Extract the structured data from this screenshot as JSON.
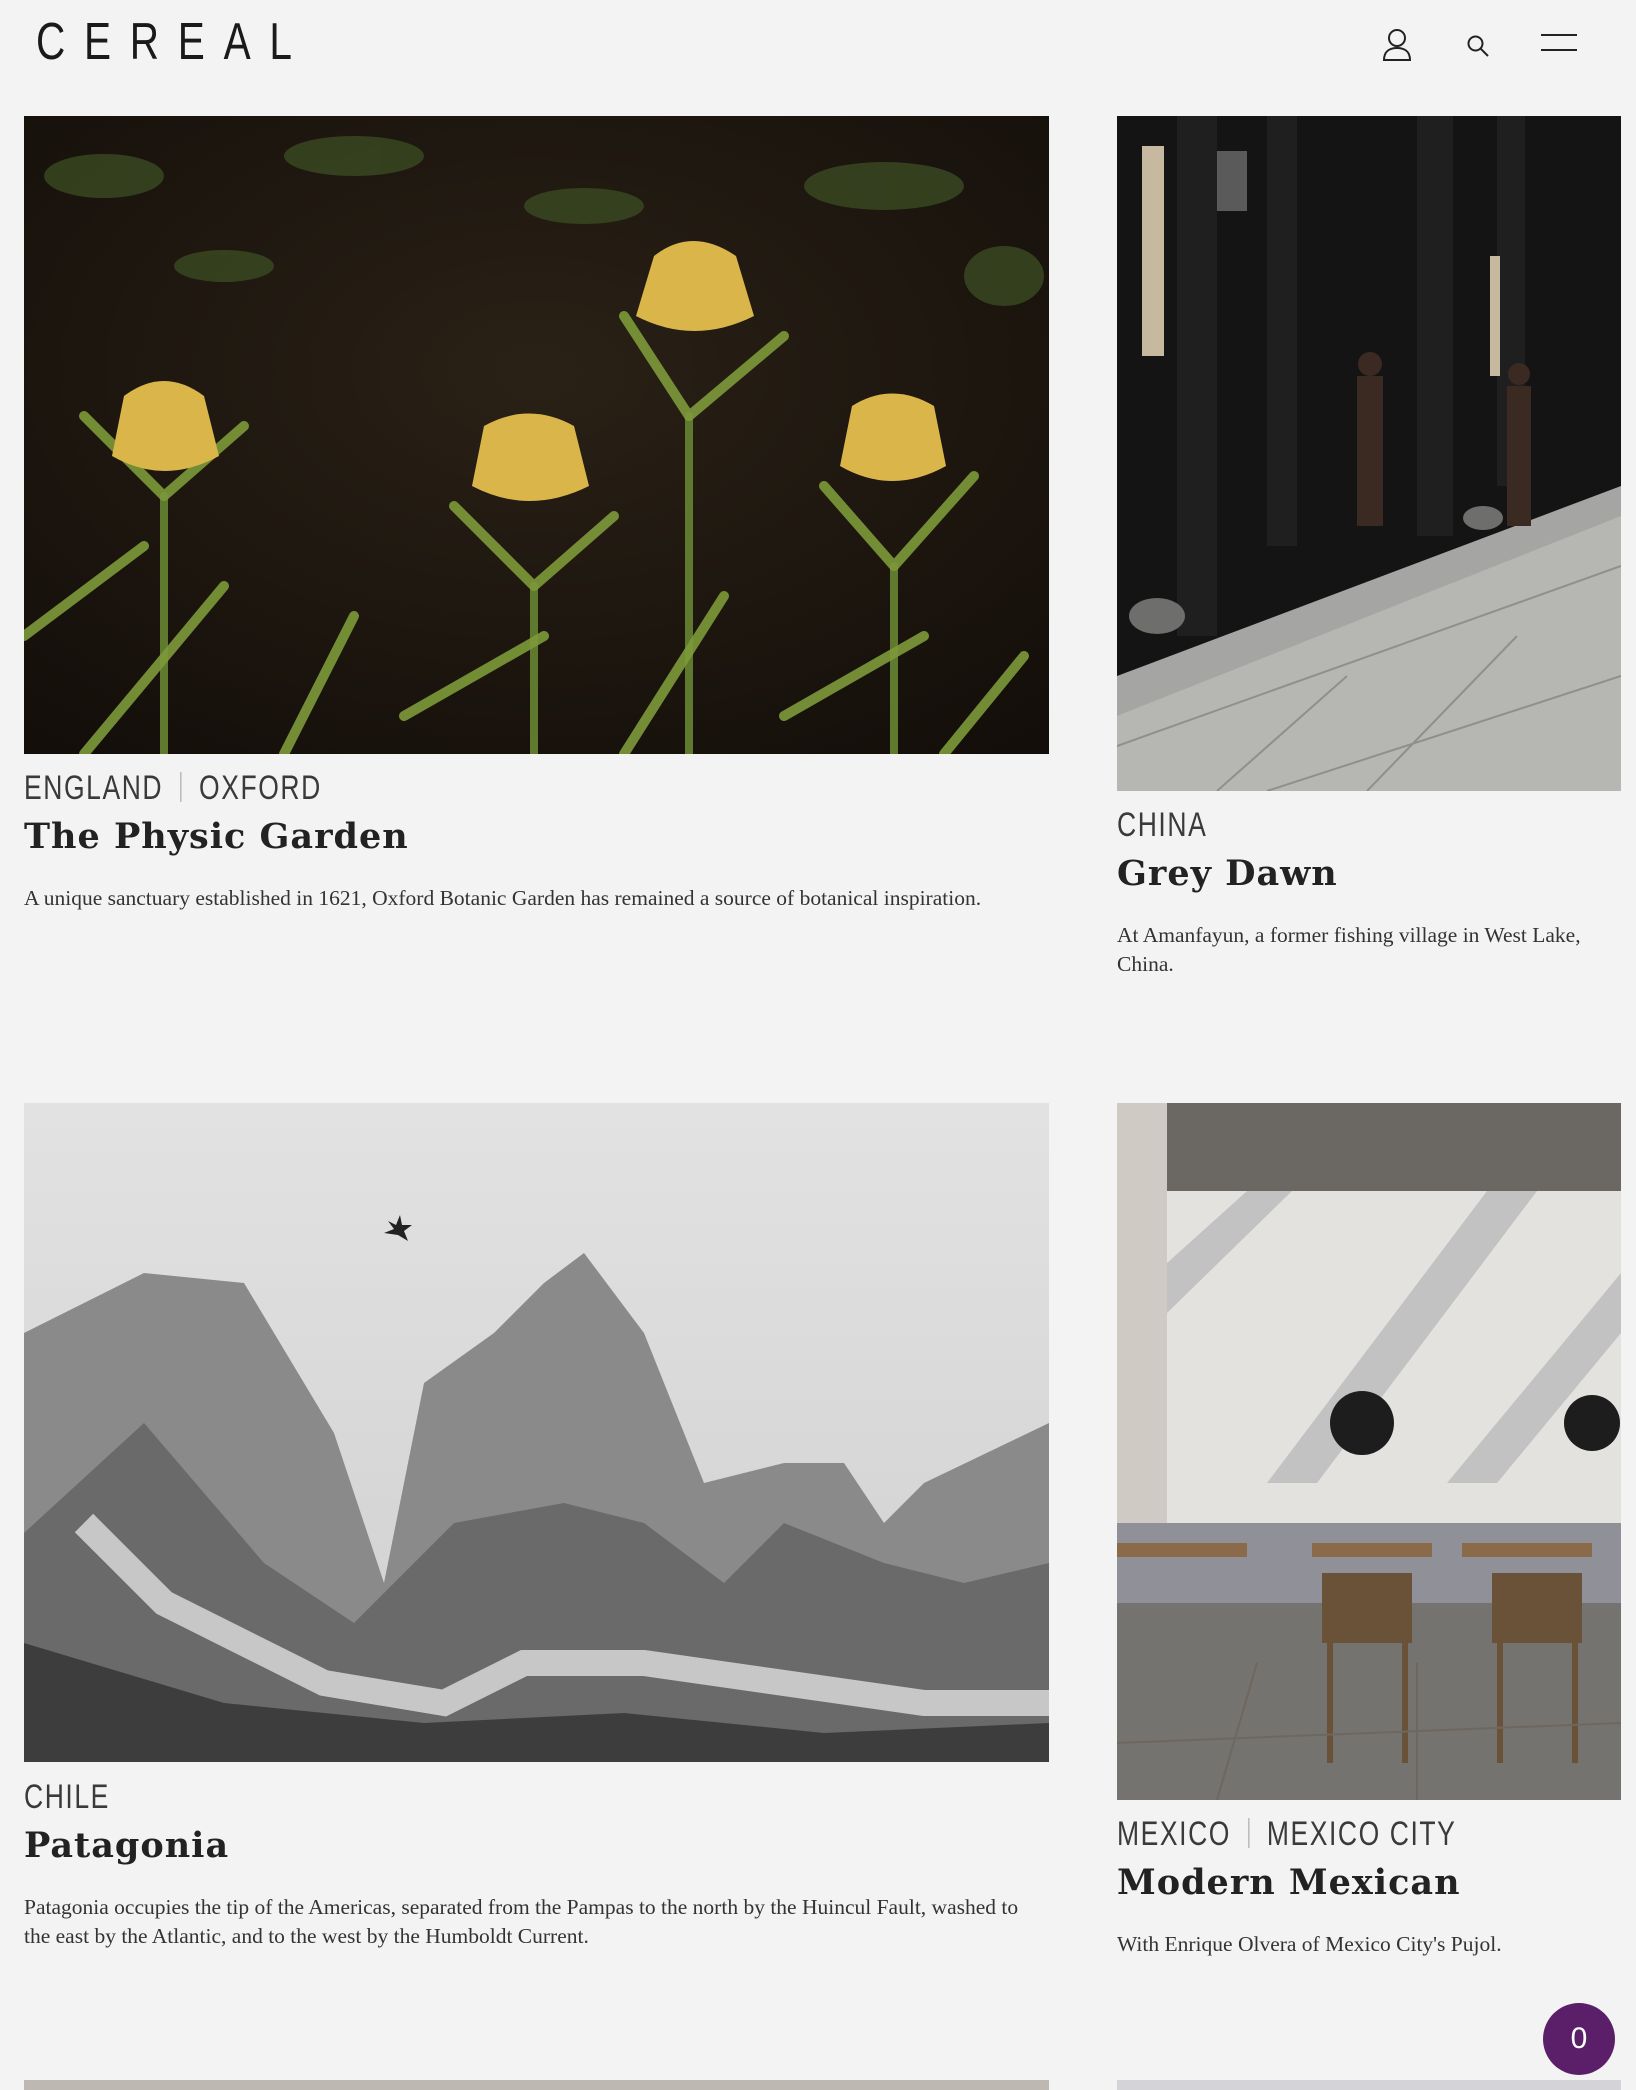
{
  "header": {
    "logo": "CEREAL",
    "icons": [
      "user-icon",
      "search-icon",
      "menu-icon"
    ]
  },
  "articles": [
    {
      "location": [
        "ENGLAND",
        "OXFORD"
      ],
      "title": "The Physic Garden",
      "description": "A unique sanctuary established in 1621, Oxford Botanic Garden has remained a source of botanical inspiration.",
      "image": "yellow fritillaria flowers in a garden"
    },
    {
      "location": [
        "CHINA"
      ],
      "title": "Grey Dawn",
      "description": "At Amanfayun, a former fishing village in West Lake, China.",
      "image": "stone walkway beside dark wooden building with two figures"
    },
    {
      "location": [
        "CHILE"
      ],
      "title": "Patagonia",
      "description": "Patagonia occupies the tip of the Americas, separated from the Pampas to the north by the Huincul Fault, washed to the east by the Atlantic, and to the west by the Humboldt Current.",
      "image": "black and white misty mountain peaks"
    },
    {
      "location": [
        "MEXICO",
        "MEXICO CITY"
      ],
      "title": "Modern Mexican",
      "description": "With Enrique Olvera of Mexico City's Pujol.",
      "image": "sunlit restaurant interior with tables and chairs"
    }
  ],
  "cart": {
    "count": "0"
  },
  "colors": {
    "background": "#f3f3f3",
    "cart": "#5a1f68"
  }
}
